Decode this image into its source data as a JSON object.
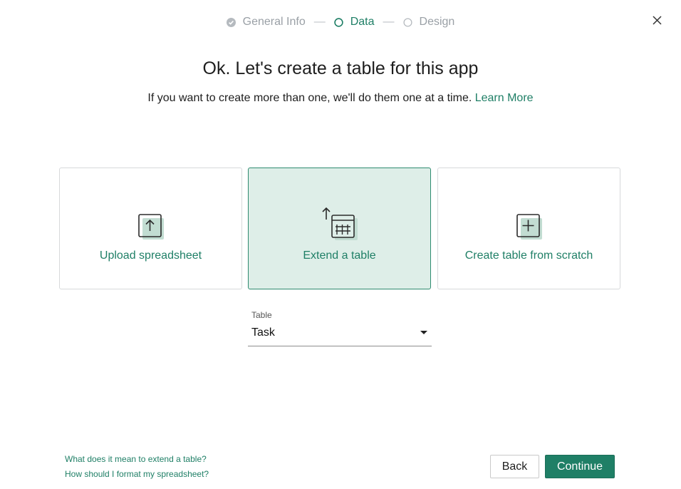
{
  "stepper": {
    "steps": [
      {
        "label": "General Info",
        "state": "done"
      },
      {
        "label": "Data",
        "state": "active"
      },
      {
        "label": "Design",
        "state": "pending"
      }
    ],
    "separator": "—"
  },
  "title": "Ok. Let's create a table for this app",
  "subtitle": {
    "text": "If you want to create more than one, we'll do them one at a time.",
    "link": "Learn More"
  },
  "cards": [
    {
      "label": "Upload spreadsheet",
      "icon": "upload-icon",
      "selected": false
    },
    {
      "label": "Extend a table",
      "icon": "extend-table-icon",
      "selected": true
    },
    {
      "label": "Create table from scratch",
      "icon": "add-table-icon",
      "selected": false
    }
  ],
  "table_select": {
    "label": "Table",
    "value": "Task"
  },
  "help_links": [
    "What does it mean to extend a table?",
    "How should I format my spreadsheet?"
  ],
  "buttons": {
    "back": "Back",
    "continue": "Continue"
  },
  "colors": {
    "accent": "#1f7f66",
    "selected_card_bg": "#deeee8",
    "muted_text": "#9aa0a6"
  }
}
